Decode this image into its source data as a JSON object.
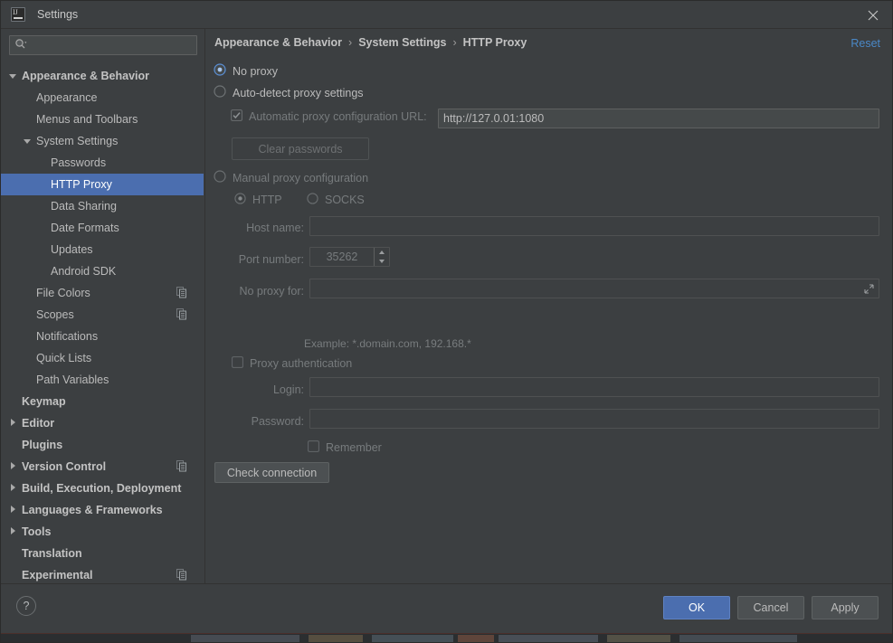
{
  "window": {
    "title": "Settings",
    "app_icon": "intellij-idea-logo",
    "close_icon": "close-icon"
  },
  "sidebar": {
    "search": {
      "value": "",
      "placeholder": "",
      "icon": "search-icon"
    },
    "items": [
      {
        "label": "Appearance & Behavior",
        "indent": 0,
        "twisty": "down",
        "bold": true,
        "selected": false,
        "copy": false
      },
      {
        "label": "Appearance",
        "indent": 1,
        "twisty": "none",
        "bold": false,
        "selected": false,
        "copy": false
      },
      {
        "label": "Menus and Toolbars",
        "indent": 1,
        "twisty": "none",
        "bold": false,
        "selected": false,
        "copy": false
      },
      {
        "label": "System Settings",
        "indent": 1,
        "twisty": "down",
        "bold": false,
        "selected": false,
        "copy": false
      },
      {
        "label": "Passwords",
        "indent": 2,
        "twisty": "none",
        "bold": false,
        "selected": false,
        "copy": false
      },
      {
        "label": "HTTP Proxy",
        "indent": 2,
        "twisty": "none",
        "bold": false,
        "selected": true,
        "copy": false
      },
      {
        "label": "Data Sharing",
        "indent": 2,
        "twisty": "none",
        "bold": false,
        "selected": false,
        "copy": false
      },
      {
        "label": "Date Formats",
        "indent": 2,
        "twisty": "none",
        "bold": false,
        "selected": false,
        "copy": false
      },
      {
        "label": "Updates",
        "indent": 2,
        "twisty": "none",
        "bold": false,
        "selected": false,
        "copy": false
      },
      {
        "label": "Android SDK",
        "indent": 2,
        "twisty": "none",
        "bold": false,
        "selected": false,
        "copy": false
      },
      {
        "label": "File Colors",
        "indent": 1,
        "twisty": "none",
        "bold": false,
        "selected": false,
        "copy": true
      },
      {
        "label": "Scopes",
        "indent": 1,
        "twisty": "none",
        "bold": false,
        "selected": false,
        "copy": true
      },
      {
        "label": "Notifications",
        "indent": 1,
        "twisty": "none",
        "bold": false,
        "selected": false,
        "copy": false
      },
      {
        "label": "Quick Lists",
        "indent": 1,
        "twisty": "none",
        "bold": false,
        "selected": false,
        "copy": false
      },
      {
        "label": "Path Variables",
        "indent": 1,
        "twisty": "none",
        "bold": false,
        "selected": false,
        "copy": false
      },
      {
        "label": "Keymap",
        "indent": 0,
        "twisty": "none",
        "bold": true,
        "selected": false,
        "copy": false
      },
      {
        "label": "Editor",
        "indent": 0,
        "twisty": "right",
        "bold": true,
        "selected": false,
        "copy": false
      },
      {
        "label": "Plugins",
        "indent": 0,
        "twisty": "none",
        "bold": true,
        "selected": false,
        "copy": false
      },
      {
        "label": "Version Control",
        "indent": 0,
        "twisty": "right",
        "bold": true,
        "selected": false,
        "copy": true
      },
      {
        "label": "Build, Execution, Deployment",
        "indent": 0,
        "twisty": "right",
        "bold": true,
        "selected": false,
        "copy": false
      },
      {
        "label": "Languages & Frameworks",
        "indent": 0,
        "twisty": "right",
        "bold": true,
        "selected": false,
        "copy": false
      },
      {
        "label": "Tools",
        "indent": 0,
        "twisty": "right",
        "bold": true,
        "selected": false,
        "copy": false
      },
      {
        "label": "Translation",
        "indent": 0,
        "twisty": "none",
        "bold": true,
        "selected": false,
        "copy": false
      },
      {
        "label": "Experimental",
        "indent": 0,
        "twisty": "none",
        "bold": true,
        "selected": false,
        "copy": true
      }
    ]
  },
  "main": {
    "breadcrumb": {
      "part1": "Appearance & Behavior",
      "part2": "System Settings",
      "part3": "HTTP Proxy",
      "separator": "›"
    },
    "reset_label": "Reset",
    "no_proxy": {
      "label": "No proxy",
      "selected": true
    },
    "auto_detect": {
      "label": "Auto-detect proxy settings",
      "selected": false
    },
    "auto_config_url": {
      "label": "Automatic proxy configuration URL:",
      "checked": true,
      "enabled": false,
      "value": "http://127.0.01:1080",
      "placeholder": ""
    },
    "clear_passwords_label": "Clear passwords",
    "manual": {
      "label": "Manual proxy configuration",
      "selected": false
    },
    "proto_http": {
      "label": "HTTP",
      "selected": true
    },
    "proto_socks": {
      "label": "SOCKS",
      "selected": false
    },
    "host_name": {
      "label": "Host name:",
      "value": "",
      "placeholder": ""
    },
    "port_number": {
      "label": "Port number:",
      "value": "35262"
    },
    "no_proxy_for": {
      "label": "No proxy for:",
      "value": "",
      "placeholder": "",
      "expand_icon": "expand-icon"
    },
    "example_hint": "Example: *.domain.com, 192.168.*",
    "proxy_auth": {
      "label": "Proxy authentication",
      "checked": false
    },
    "login": {
      "label": "Login:",
      "value": "",
      "placeholder": ""
    },
    "password": {
      "label": "Password:",
      "value": "",
      "placeholder": ""
    },
    "remember": {
      "label": "Remember",
      "checked": false
    },
    "check_connection_label": "Check connection"
  },
  "footer": {
    "help_label": "?",
    "ok_label": "OK",
    "cancel_label": "Cancel",
    "apply_label": "Apply"
  },
  "colors": {
    "accent_selection": "#4b6eaf",
    "link": "#4a88c7",
    "panel_bg": "#3c3f41",
    "field_bg": "#45494a",
    "text": "#bbbbbb",
    "text_dim": "#777b7d"
  }
}
